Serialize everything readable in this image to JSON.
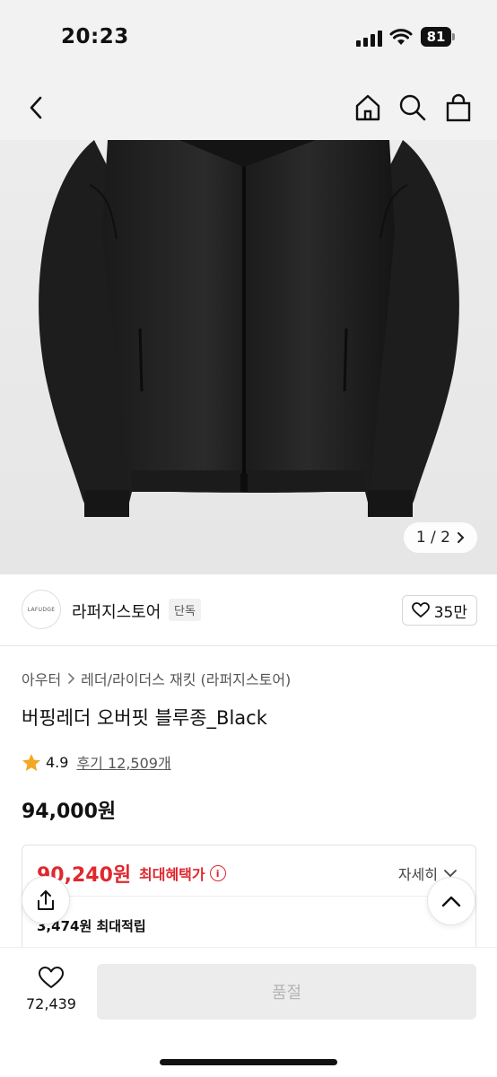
{
  "status_bar": {
    "time": "20:23",
    "battery": "81"
  },
  "nav": {
    "back_icon": "chevron-left-icon",
    "home_icon": "home-icon",
    "search_icon": "search-icon",
    "cart_icon": "bag-icon"
  },
  "gallery": {
    "counter": "1 / 2"
  },
  "store": {
    "logo_text": "LAFUDGE",
    "name": "라퍼지스토어",
    "badge": "단독",
    "like_count": "35만"
  },
  "product": {
    "breadcrumb": [
      "아우터",
      "레더/라이더스 재킷 (라퍼지스토어)"
    ],
    "title": "버핑레더 오버핏 블루종_Black",
    "rating": "4.9",
    "reviews": "후기 12,509개",
    "price": "94,000원"
  },
  "benefit": {
    "max_price": "90,240원",
    "max_label": "최대혜택가",
    "detail_label": "자세히",
    "points_label": "3,474원 최대적립"
  },
  "bottom_bar": {
    "wish_count": "72,439",
    "buy_label": "품절"
  },
  "colors": {
    "accent_red": "#e0282e",
    "star": "#f5a623"
  }
}
